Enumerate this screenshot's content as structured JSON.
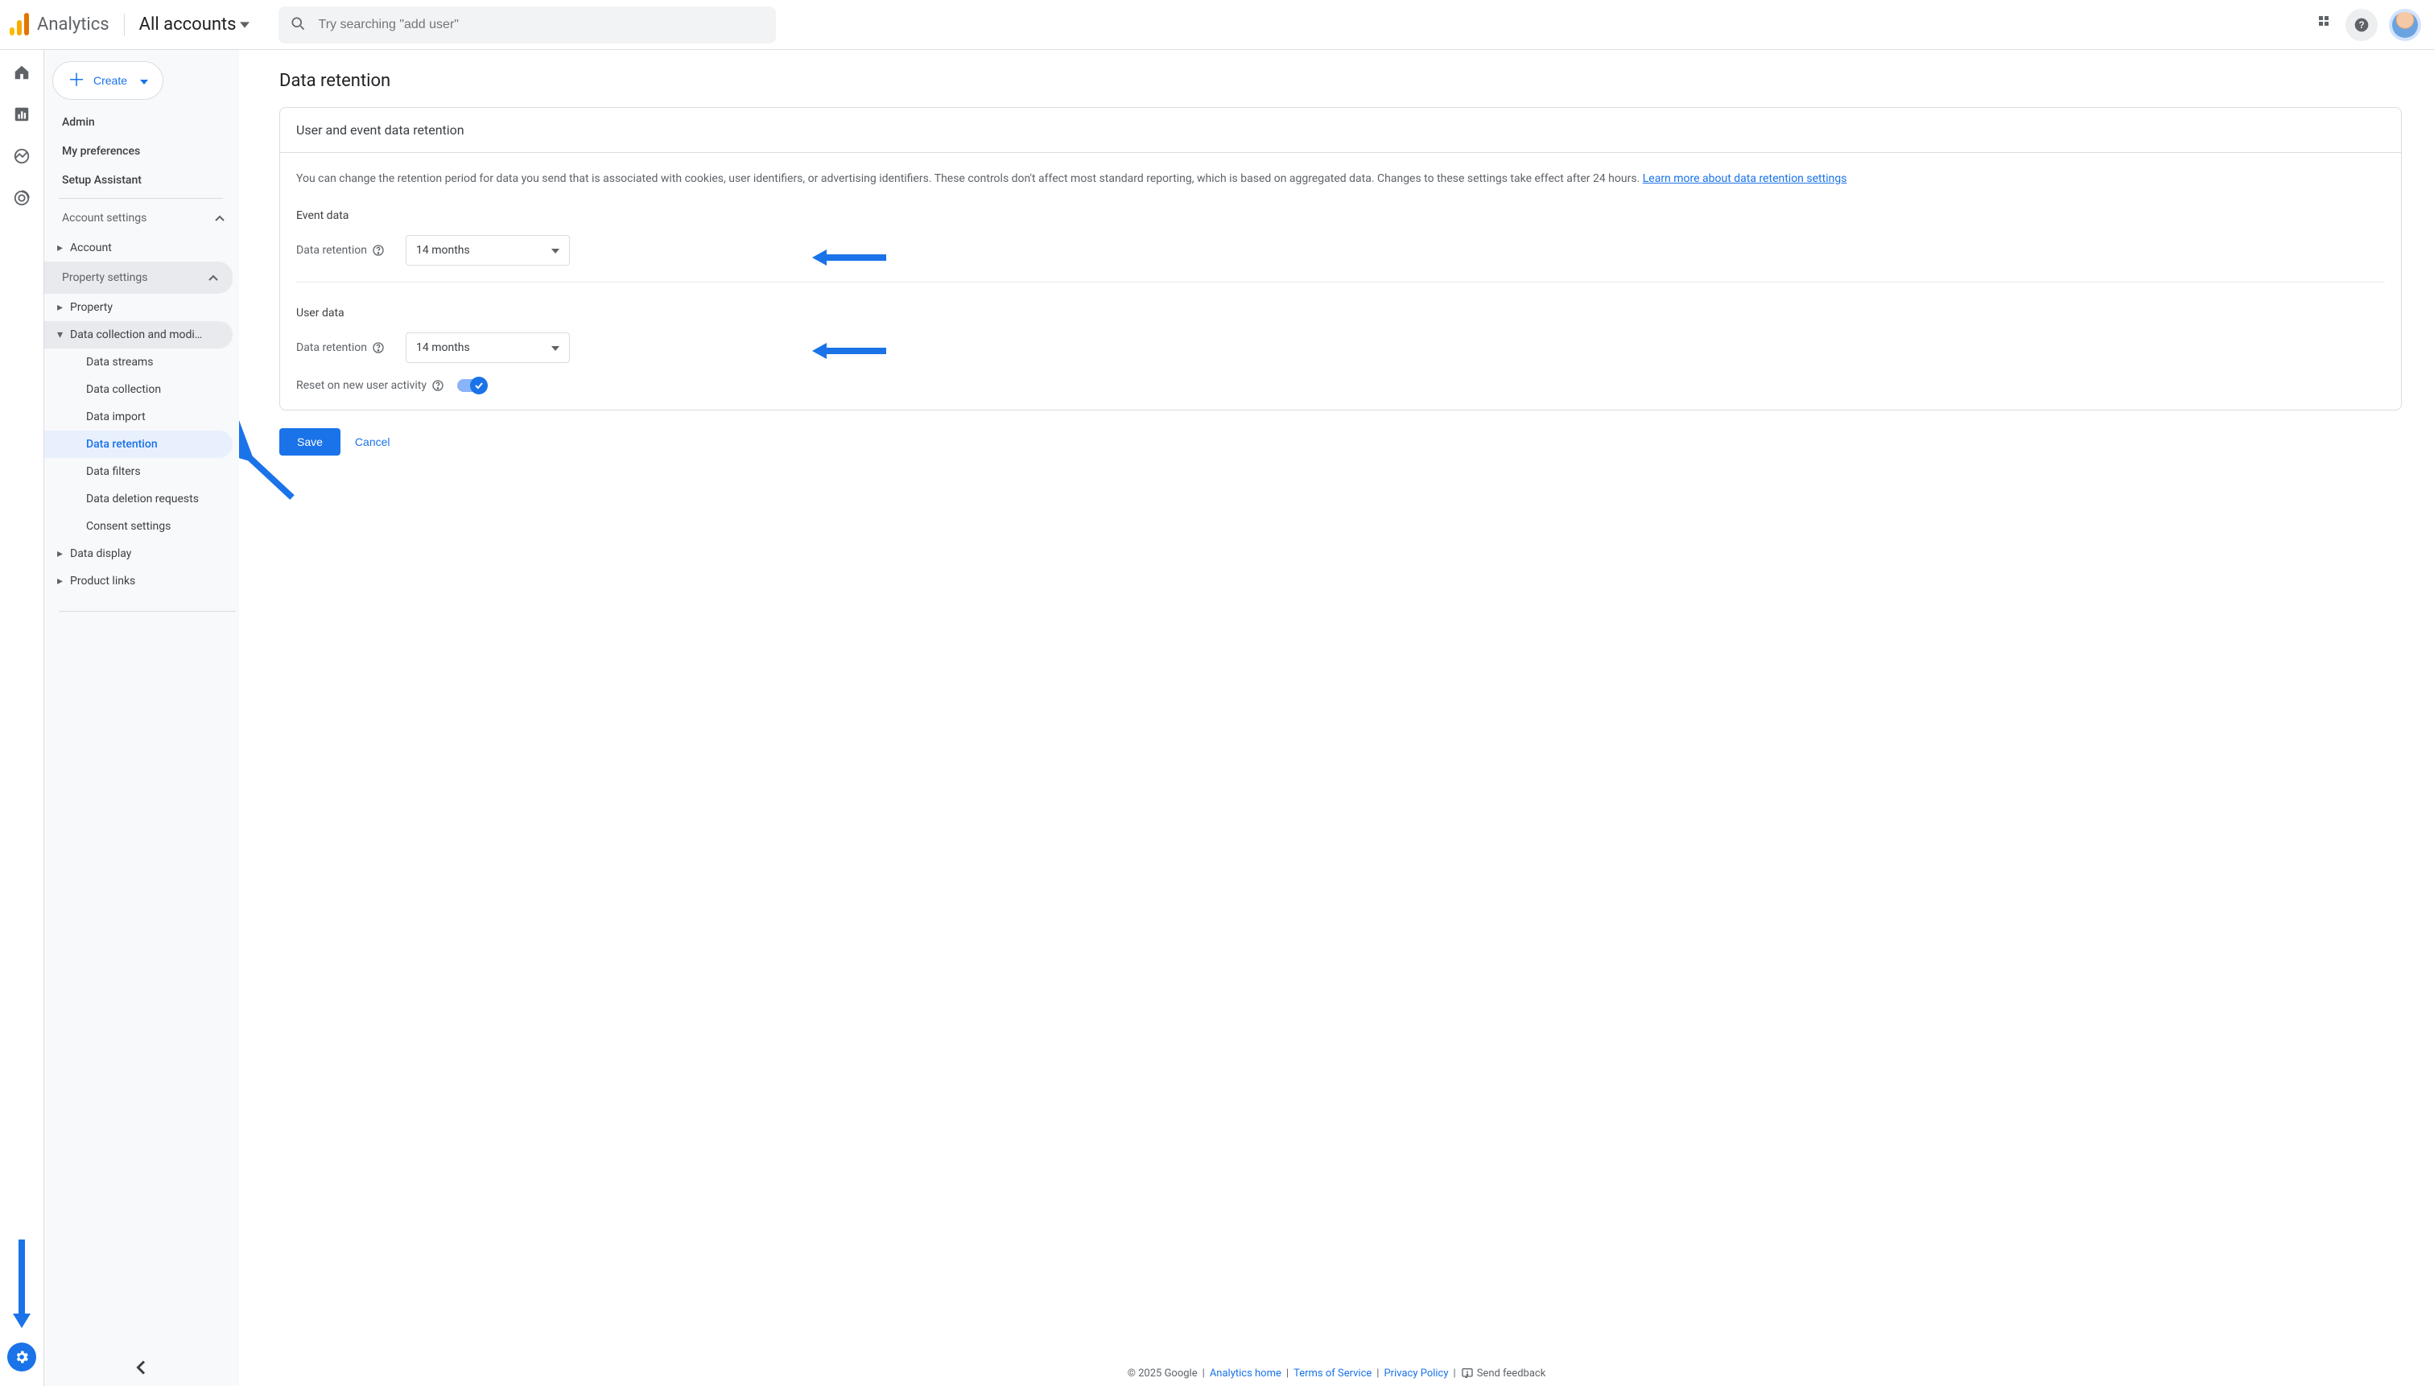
{
  "header": {
    "brand": "Analytics",
    "account_picker": "All accounts",
    "search_placeholder": "Try searching \"add user\""
  },
  "sidepanel": {
    "create_label": "Create",
    "top_items": [
      "Admin",
      "My preferences",
      "Setup Assistant"
    ],
    "account_settings_label": "Account settings",
    "account_item": "Account",
    "property_settings_label": "Property settings",
    "property_item": "Property",
    "data_collection_item": "Data collection and modifica…",
    "sub_items": {
      "data_streams": "Data streams",
      "data_collection": "Data collection",
      "data_import": "Data import",
      "data_retention": "Data retention",
      "data_filters": "Data filters",
      "data_deletion": "Data deletion requests",
      "consent": "Consent settings"
    },
    "data_display": "Data display",
    "product_links": "Product links"
  },
  "page": {
    "title": "Data retention",
    "card_title": "User and event data retention",
    "intro": "You can change the retention period for data you send that is associated with cookies, user identifiers, or advertising identifiers. These controls don't affect most standard reporting, which is based on aggregated data. Changes to these settings take effect after 24 hours. ",
    "learn_more": "Learn more about data retention settings",
    "event_heading": "Event data",
    "user_heading": "User data",
    "retention_label": "Data retention",
    "event_value": "14 months",
    "user_value": "14 months",
    "reset_label": "Reset on new user activity",
    "save": "Save",
    "cancel": "Cancel"
  },
  "footer": {
    "copyright": "© 2025 Google",
    "analytics_home": "Analytics home",
    "terms": "Terms of Service",
    "privacy": "Privacy Policy",
    "feedback": "Send feedback"
  }
}
